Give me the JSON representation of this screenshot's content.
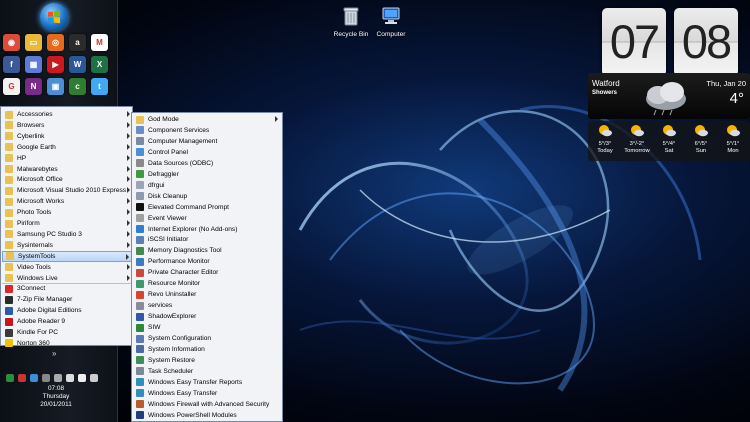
{
  "desktop": {
    "icons": [
      {
        "label": "Recycle Bin",
        "icon": "recycle-bin-icon"
      },
      {
        "label": "Computer",
        "icon": "computer-icon"
      }
    ]
  },
  "taskbar": {
    "quick_launch": [
      {
        "icon": "chrome-icon",
        "color": "#dd4b39",
        "glyph": "◉"
      },
      {
        "icon": "folder-icon",
        "color": "#e8b93a",
        "glyph": "▭"
      },
      {
        "icon": "firefox-icon",
        "color": "#e66a1b",
        "glyph": "◎"
      },
      {
        "icon": "amazon-icon",
        "color": "#2b2b2b",
        "glyph": "a"
      },
      {
        "icon": "gmail-icon",
        "color": "#ffffff",
        "glyph": "M"
      },
      {
        "icon": "facebook-icon",
        "color": "#3b5998",
        "glyph": "f"
      },
      {
        "icon": "calendar-icon",
        "color": "#5b7bd5",
        "glyph": "▦"
      },
      {
        "icon": "youtube-icon",
        "color": "#cc181e",
        "glyph": "▶"
      },
      {
        "icon": "word-icon",
        "color": "#2b5797",
        "glyph": "W"
      },
      {
        "icon": "excel-icon",
        "color": "#1e7145",
        "glyph": "X"
      },
      {
        "icon": "google-icon",
        "color": "#f2f2f2",
        "glyph": "G"
      },
      {
        "icon": "onenote-icon",
        "color": "#7a2b8a",
        "glyph": "N"
      },
      {
        "icon": "photo-icon",
        "color": "#4a8fd6",
        "glyph": "▣"
      },
      {
        "icon": "cnet-icon",
        "color": "#2e7d32",
        "glyph": "c"
      },
      {
        "icon": "twitter-icon",
        "color": "#3fa9f5",
        "glyph": "t"
      }
    ],
    "tray_icons": [
      "shield-icon",
      "cross-icon",
      "globe-icon",
      "network-icon",
      "sync-icon",
      "speaker-icon",
      "flag-icon",
      "pin-icon"
    ],
    "clock": {
      "time": "07:08",
      "day": "Thursday",
      "date": "20/01/2011"
    },
    "expand_label": "»"
  },
  "start_menu": {
    "items": [
      {
        "label": "Accessories",
        "icon": "folder-icon",
        "color": "#e8c252",
        "submenu": true
      },
      {
        "label": "Browsers",
        "icon": "folder-icon",
        "color": "#e8c252",
        "submenu": true
      },
      {
        "label": "Cyberlink",
        "icon": "folder-icon",
        "color": "#e8c252",
        "submenu": true
      },
      {
        "label": "Google Earth",
        "icon": "folder-icon",
        "color": "#e8c252",
        "submenu": true
      },
      {
        "label": "HP",
        "icon": "folder-icon",
        "color": "#e8c252",
        "submenu": true
      },
      {
        "label": "Malwarebytes",
        "icon": "folder-icon",
        "color": "#e8c252",
        "submenu": true
      },
      {
        "label": "Microsoft Office",
        "icon": "folder-icon",
        "color": "#e8c252",
        "submenu": true
      },
      {
        "label": "Microsoft Visual Studio 2010 Express",
        "icon": "folder-icon",
        "color": "#e8c252",
        "submenu": true
      },
      {
        "label": "Microsoft Works",
        "icon": "folder-icon",
        "color": "#e8c252",
        "submenu": true
      },
      {
        "label": "Photo Tools",
        "icon": "folder-icon",
        "color": "#e8c252",
        "submenu": true
      },
      {
        "label": "Piriform",
        "icon": "folder-icon",
        "color": "#e8c252",
        "submenu": true
      },
      {
        "label": "Samsung PC Studio 3",
        "icon": "folder-icon",
        "color": "#e8c252",
        "submenu": true
      },
      {
        "label": "Sysinternals",
        "icon": "folder-icon",
        "color": "#e8c252",
        "submenu": true
      },
      {
        "label": "SystemTools",
        "icon": "folder-icon",
        "color": "#e8c252",
        "submenu": true,
        "selected": true
      },
      {
        "label": "Video Tools",
        "icon": "folder-icon",
        "color": "#e8c252",
        "submenu": true
      },
      {
        "label": "Windows Live",
        "icon": "folder-icon",
        "color": "#e8c252",
        "submenu": true
      },
      {
        "label": "3Connect",
        "icon": "connect-icon",
        "color": "#d62828",
        "submenu": false
      },
      {
        "label": "7-Zip File Manager",
        "icon": "zip-icon",
        "color": "#2b2b2b",
        "submenu": false
      },
      {
        "label": "Adobe Digital Editions",
        "icon": "adobe-de-icon",
        "color": "#2b5aa6",
        "submenu": false
      },
      {
        "label": "Adobe Reader 9",
        "icon": "adobe-reader-icon",
        "color": "#c8161d",
        "submenu": false
      },
      {
        "label": "Kindle For PC",
        "icon": "kindle-icon",
        "color": "#3a3a3a",
        "submenu": false
      },
      {
        "label": "Norton 360",
        "icon": "norton-icon",
        "color": "#f2c200",
        "submenu": false
      }
    ]
  },
  "submenu": {
    "items": [
      {
        "label": "God Mode",
        "icon": "folder-icon",
        "color": "#e8c252",
        "submenu": true
      },
      {
        "label": "Component Services",
        "icon": "component-services-icon",
        "color": "#6a8fc8"
      },
      {
        "label": "Computer Management",
        "icon": "computer-management-icon",
        "color": "#7a8aa0"
      },
      {
        "label": "Control Panel",
        "icon": "control-panel-icon",
        "color": "#4a90d9"
      },
      {
        "label": "Data Sources (ODBC)",
        "icon": "odbc-icon",
        "color": "#8a8a8a"
      },
      {
        "label": "Defraggler",
        "icon": "defraggler-icon",
        "color": "#3d9b3d"
      },
      {
        "label": "dfrgui",
        "icon": "disk-icon",
        "color": "#9aa5b5"
      },
      {
        "label": "Disk Cleanup",
        "icon": "disk-cleanup-icon",
        "color": "#8c9bb0"
      },
      {
        "label": "Elevated Command Prompt",
        "icon": "cmd-icon",
        "color": "#111111"
      },
      {
        "label": "Event Viewer",
        "icon": "event-viewer-icon",
        "color": "#a0a0a0"
      },
      {
        "label": "Internet Explorer (No Add-ons)",
        "icon": "ie-icon",
        "color": "#2f7fd1"
      },
      {
        "label": "iSCSI Initiator",
        "icon": "iscsi-icon",
        "color": "#5a7fb5"
      },
      {
        "label": "Memory Diagnostics Tool",
        "icon": "memory-icon",
        "color": "#3e8a4f"
      },
      {
        "label": "Performance Monitor",
        "icon": "performance-icon",
        "color": "#3c7bc0"
      },
      {
        "label": "Private Character Editor",
        "icon": "character-editor-icon",
        "color": "#c94a3a"
      },
      {
        "label": "Resource Monitor",
        "icon": "resource-monitor-icon",
        "color": "#3a9a6a"
      },
      {
        "label": "Revo Uninstaller",
        "icon": "revo-icon",
        "color": "#d6452b"
      },
      {
        "label": "services",
        "icon": "services-icon",
        "color": "#8a8a9a"
      },
      {
        "label": "ShadowExplorer",
        "icon": "shadow-explorer-icon",
        "color": "#3355aa"
      },
      {
        "label": "SIW",
        "icon": "siw-icon",
        "color": "#2a8a3a"
      },
      {
        "label": "System Configuration",
        "icon": "msconfig-icon",
        "color": "#5a7ab5"
      },
      {
        "label": "System Information",
        "icon": "sysinfo-icon",
        "color": "#4a6aa5"
      },
      {
        "label": "System Restore",
        "icon": "restore-icon",
        "color": "#3f8f55"
      },
      {
        "label": "Task Scheduler",
        "icon": "scheduler-icon",
        "color": "#7a8a9a"
      },
      {
        "label": "Windows Easy Transfer Reports",
        "icon": "easy-transfer-icon",
        "color": "#2f8fbf"
      },
      {
        "label": "Windows Easy Transfer",
        "icon": "easy-transfer-icon",
        "color": "#2f8fbf"
      },
      {
        "label": "Windows Firewall with Advanced Security",
        "icon": "firewall-icon",
        "color": "#b85a2a"
      },
      {
        "label": "Windows PowerShell Modules",
        "icon": "powershell-icon",
        "color": "#1f3f7a"
      }
    ]
  },
  "weather_widget": {
    "hour": "07",
    "minute": "08",
    "city": "Watford",
    "condition": "Showers",
    "date": "Thu, Jan 20",
    "temperature": "4°",
    "forecast": [
      {
        "temps": "5°/3°",
        "day": "Today",
        "icon": "partly-cloudy-icon"
      },
      {
        "temps": "3°/-2°",
        "day": "Tomorrow",
        "icon": "partly-cloudy-icon"
      },
      {
        "temps": "5°/4°",
        "day": "Sat",
        "icon": "partly-cloudy-icon"
      },
      {
        "temps": "6°/5°",
        "day": "Sun",
        "icon": "partly-cloudy-icon"
      },
      {
        "temps": "5°/1°",
        "day": "Mon",
        "icon": "partly-cloudy-icon"
      }
    ]
  },
  "colors": {
    "accent": "#1b6fc4",
    "menu_bg": "#f1f3f7",
    "selection": "#bcd6f6"
  }
}
